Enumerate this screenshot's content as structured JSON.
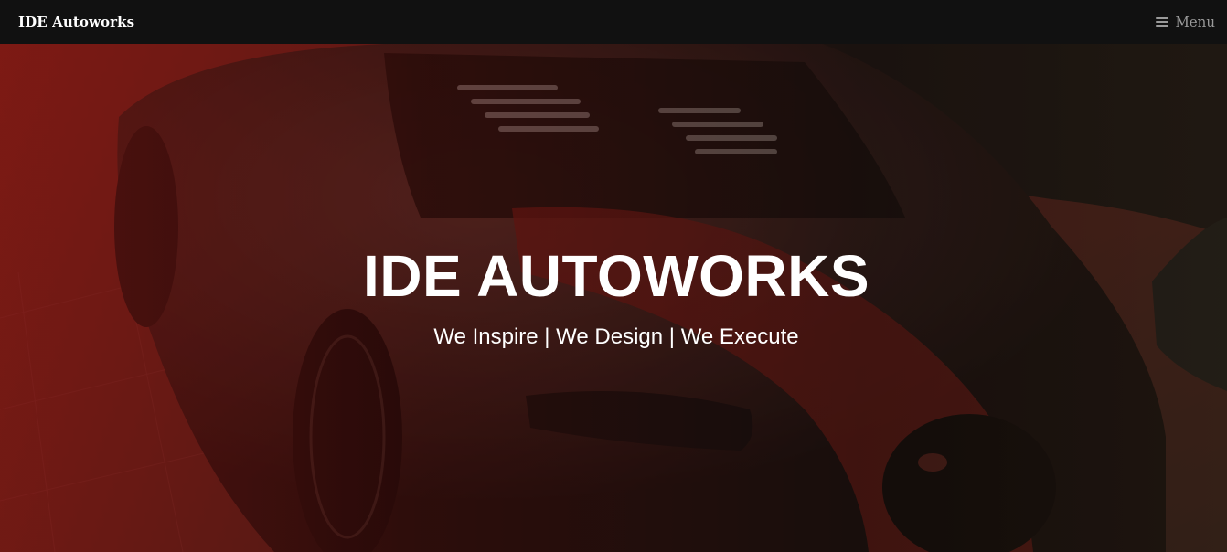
{
  "navbar": {
    "brand": "IDE Autoworks",
    "menu_label": "Menu"
  },
  "hero": {
    "title": "IDE AUTOWORKS",
    "subtitle": "We Inspire | We Design | We Execute"
  },
  "icons": {
    "menu": "hamburger-icon"
  },
  "colors": {
    "navbar_bg": "#111111",
    "menu_text": "#9a9a9a",
    "hero_text": "#ffffff",
    "accent_red": "#b0221c"
  }
}
